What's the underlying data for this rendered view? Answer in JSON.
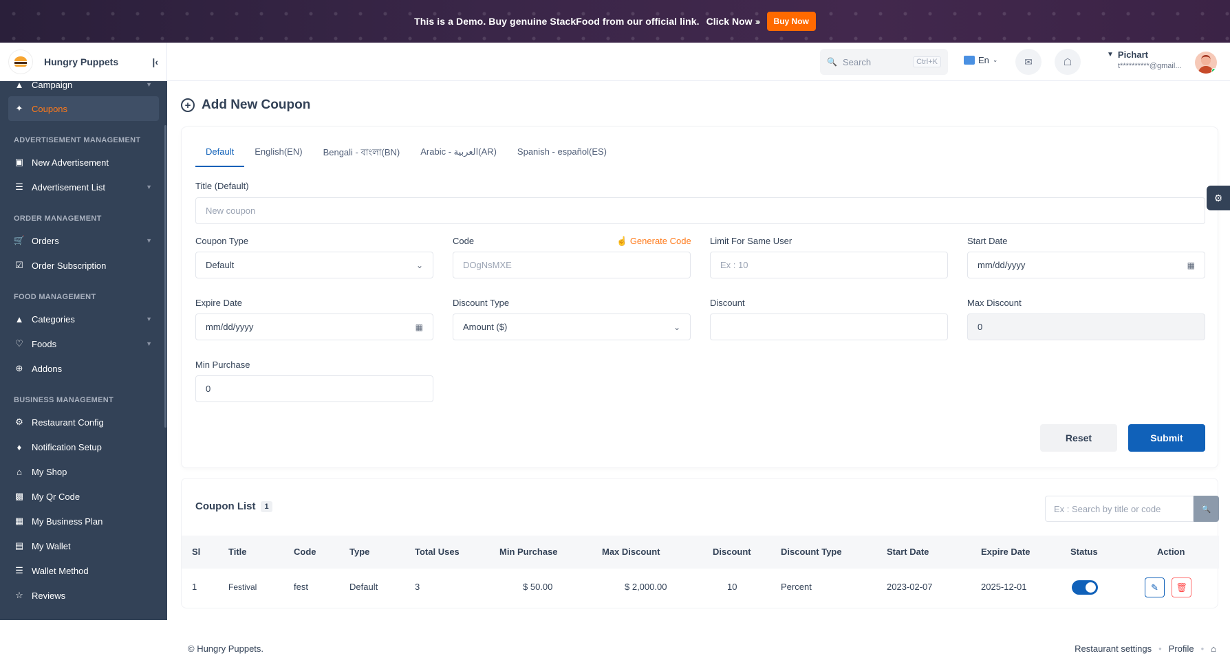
{
  "banner": {
    "text": "This is a Demo. Buy genuine StackFood from our official link.",
    "click_now": "Click Now",
    "buy_now": "Buy Now"
  },
  "brand": {
    "name": "Hungry Puppets"
  },
  "sidebar": {
    "items_top": [
      {
        "label": "Campaign",
        "icon": "campaign-icon"
      },
      {
        "label": "Coupons",
        "icon": "tag-icon",
        "active": true
      }
    ],
    "sections": [
      {
        "heading": "ADVERTISEMENT MANAGEMENT",
        "items": [
          "New Advertisement",
          "Advertisement List"
        ]
      },
      {
        "heading": "ORDER MANAGEMENT",
        "items": [
          "Orders",
          "Order Subscription"
        ]
      },
      {
        "heading": "FOOD MANAGEMENT",
        "items": [
          "Categories",
          "Foods",
          "Addons"
        ]
      },
      {
        "heading": "BUSINESS MANAGEMENT",
        "items": [
          "Restaurant Config",
          "Notification Setup",
          "My Shop",
          "My Qr Code",
          "My Business Plan",
          "My Wallet",
          "Wallet Method",
          "Reviews"
        ]
      }
    ]
  },
  "header": {
    "search_placeholder": "Search",
    "search_shortcut": "Ctrl+K",
    "language": "En",
    "user_name": "Pichart",
    "user_email": "t**********@gmail..."
  },
  "page": {
    "title": "Add New Coupon"
  },
  "tabs": [
    "Default",
    "English(EN)",
    "Bengali - বাংলা(BN)",
    "Arabic - العربية(AR)",
    "Spanish - español(ES)"
  ],
  "form": {
    "title_label": "Title (Default)",
    "title_placeholder": "New coupon",
    "coupon_type_label": "Coupon Type",
    "coupon_type_value": "Default",
    "code_label": "Code",
    "generate_code": "Generate Code",
    "code_placeholder": "DOgNsMXE",
    "limit_label": "Limit For Same User",
    "limit_placeholder": "Ex : 10",
    "start_date_label": "Start Date",
    "start_date_placeholder": "mm/dd/yyyy",
    "expire_date_label": "Expire Date",
    "expire_date_placeholder": "mm/dd/yyyy",
    "discount_type_label": "Discount Type",
    "discount_type_value": "Amount ($)",
    "discount_label": "Discount",
    "discount_value": "",
    "max_discount_label": "Max Discount",
    "max_discount_value": "0",
    "min_purchase_label": "Min Purchase",
    "min_purchase_value": "0",
    "reset": "Reset",
    "submit": "Submit"
  },
  "coupon_list": {
    "title": "Coupon List",
    "count": "1",
    "search_placeholder": "Ex : Search by title or code",
    "columns": [
      "Sl",
      "Title",
      "Code",
      "Type",
      "Total Uses",
      "Min Purchase",
      "Max Discount",
      "Discount",
      "Discount Type",
      "Start Date",
      "Expire Date",
      "Status",
      "Action"
    ],
    "rows": [
      {
        "sl": "1",
        "title": "Festival",
        "code": "fest",
        "type": "Default",
        "total_uses": "3",
        "min_purchase": "$ 50.00",
        "max_discount": "$ 2,000.00",
        "discount": "10",
        "discount_type": "Percent",
        "start_date": "2023-02-07",
        "expire_date": "2025-12-01",
        "status": true
      }
    ]
  },
  "footer": {
    "copyright": "© Hungry Puppets.",
    "links": [
      "Restaurant settings",
      "Profile"
    ]
  },
  "colors": {
    "primary": "#1061b9",
    "accent": "#ff7a1a",
    "sidebar": "#334257"
  }
}
